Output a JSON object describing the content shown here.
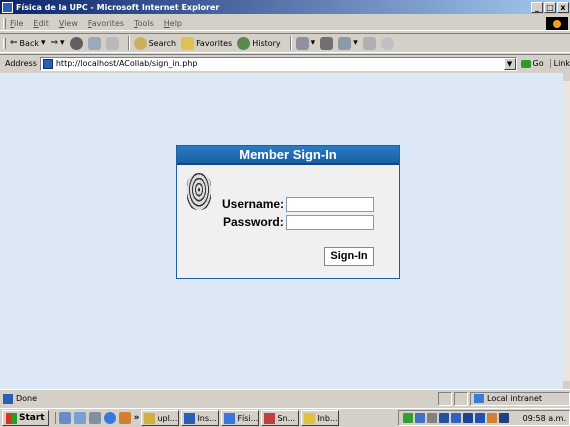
{
  "window": {
    "title": "Física de la UPC - Microsoft Internet Explorer",
    "minimize": "_",
    "maximize": "□",
    "close": "x"
  },
  "menubar": {
    "items": [
      "File",
      "Edit",
      "View",
      "Favorites",
      "Tools",
      "Help"
    ]
  },
  "toolbar": {
    "back": "Back",
    "back_arrow": "⇐",
    "forward_arrow": "⇒",
    "search": "Search",
    "favorites": "Favorites",
    "history": "History"
  },
  "address": {
    "label": "Address",
    "url": "http://localhost/ACollab/sign_in.php",
    "go": "Go",
    "links": "Link"
  },
  "signin": {
    "title": "Member Sign-In",
    "username_label": "Username:",
    "password_label": "Password:",
    "username_value": "",
    "password_value": "",
    "button": "Sign-In"
  },
  "status": {
    "text": "Done",
    "zone": "Local intranet"
  },
  "taskbar": {
    "start": "Start",
    "more": "»",
    "tasks": [
      "upl...",
      "Ins...",
      "Físi...",
      "Sn...",
      "Inb..."
    ],
    "clock": "09:58 a.m."
  },
  "colors": {
    "header_blue": "#1a5fa3",
    "page_bg": "#dde8f6",
    "title_gradient_start": "#0a246a"
  }
}
